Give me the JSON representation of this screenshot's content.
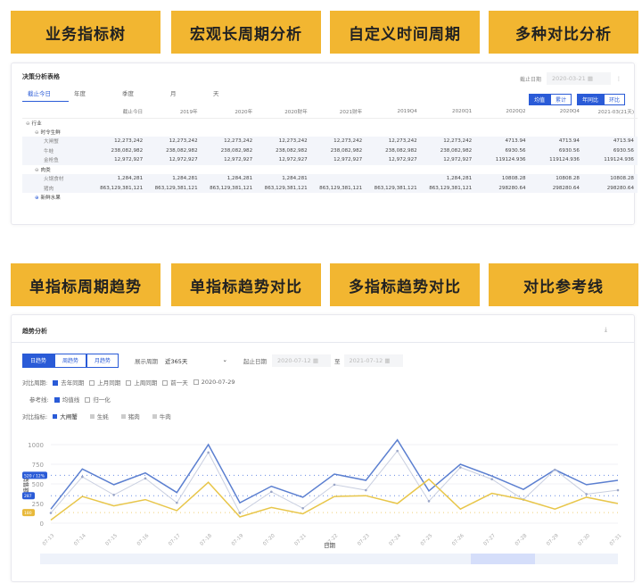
{
  "features_top": [
    "业务指标树",
    "宏观长周期分析",
    "自定义时间周期",
    "多种对比分析"
  ],
  "features_bottom": [
    "单指标周期趋势",
    "单指标趋势对比",
    "多指标趋势对比",
    "对比参考线"
  ],
  "table_panel": {
    "title": "决策分析表格",
    "tabs": [
      "截止今日",
      "年度",
      "季度",
      "月",
      "天"
    ],
    "date_label": "截止日期",
    "date_value": "2020-03-21",
    "mode_buttons": [
      "均值",
      "累计"
    ],
    "compare_buttons": [
      "年同比",
      "环比"
    ],
    "columns": [
      "截止今日",
      "2019年",
      "2020年",
      "2020财年",
      "2021财年",
      "2019Q4",
      "2020Q1",
      "2020Q2",
      "2020Q4",
      "2021-03(21天)"
    ],
    "rows": [
      {
        "label": "行业",
        "level": 0,
        "icon": "minus",
        "values": []
      },
      {
        "label": "时令生鲜",
        "level": 1,
        "icon": "minus",
        "values": []
      },
      {
        "label": "大闸蟹",
        "level": 2,
        "values": [
          "12,273,242",
          "12,273,242",
          "12,273,242",
          "12,273,242",
          "12,273,242",
          "12,273,242",
          "12,273,242",
          "4713.94",
          "4713.94",
          "4713.94"
        ]
      },
      {
        "label": "牛蛙",
        "level": 2,
        "values": [
          "238,082,982",
          "238,082,982",
          "238,082,982",
          "238,082,982",
          "238,082,982",
          "238,082,982",
          "238,082,982",
          "6930.56",
          "6930.56",
          "6930.56"
        ]
      },
      {
        "label": "金枪鱼",
        "level": 2,
        "values": [
          "12,972,927",
          "12,972,927",
          "12,972,927",
          "12,972,927",
          "12,972,927",
          "12,972,927",
          "12,972,927",
          "119124.936",
          "119124.936",
          "119124.936"
        ]
      },
      {
        "label": "肉类",
        "level": 1,
        "icon": "minus",
        "values": []
      },
      {
        "label": "火锅食材",
        "level": 2,
        "values": [
          "1,284,281",
          "1,284,281",
          "1,284,281",
          "1,284,281",
          "",
          "",
          "1,284,281",
          "10808.28",
          "10808.28",
          "10808.28"
        ]
      },
      {
        "label": "猪肉",
        "level": 2,
        "values": [
          "863,129,381,121",
          "863,129,381,121",
          "863,129,381,121",
          "863,129,381,121",
          "863,129,381,121",
          "863,129,381,121",
          "863,129,381,121",
          "298280.64",
          "298280.64",
          "298280.64"
        ]
      },
      {
        "label": "新鲜水果",
        "level": 1,
        "icon": "plus",
        "values": []
      }
    ]
  },
  "trend_panel": {
    "title": "趋势分析",
    "granularity": [
      "日趋势",
      "周趋势",
      "月趋势"
    ],
    "period_label": "展示周期",
    "period_value": "近365天",
    "range_label": "起止日期",
    "range_start": "2020-07-12",
    "range_sep": "至",
    "range_end": "2021-07-12",
    "compare_label": "对比周期:",
    "compare_options": [
      {
        "label": "去年同期",
        "checked": true
      },
      {
        "label": "上月同期",
        "checked": false
      },
      {
        "label": "上周同期",
        "checked": false
      },
      {
        "label": "前一天",
        "checked": false
      },
      {
        "label": "2020-07-29",
        "checked": false
      }
    ],
    "ref_label": "参考线:",
    "ref_options": [
      {
        "label": "均值线",
        "checked": true
      },
      {
        "label": "归一化",
        "checked": false
      }
    ],
    "metric_label": "对比指标:",
    "metrics": [
      "大闸蟹",
      "生蚝",
      "猪肉",
      "牛肉"
    ]
  },
  "chart_data": {
    "type": "line",
    "xlabel": "日期",
    "ylabel": "销售额",
    "ylim": [
      0,
      1000
    ],
    "yticks": [
      "0",
      "250",
      "500",
      "750",
      "1000"
    ],
    "categories": [
      "07-13",
      "07-14",
      "07-15",
      "07-16",
      "07-17",
      "07-18",
      "07-19",
      "07-20",
      "07-21",
      "07-22",
      "07-23",
      "07-24",
      "07-25",
      "07-26",
      "07-27",
      "07-28",
      "07-29",
      "07-30",
      "07-31"
    ],
    "series": [
      {
        "name": "大闸蟹",
        "color": "#5b7fd0",
        "values": [
          180,
          690,
          490,
          640,
          390,
          1000,
          260,
          470,
          330,
          625,
          545,
          1060,
          410,
          750,
          600,
          430,
          680,
          490,
          545
        ]
      },
      {
        "name": "去年同期",
        "color": "#c9cfe0",
        "values": [
          130,
          590,
          360,
          570,
          260,
          900,
          130,
          400,
          190,
          490,
          420,
          920,
          280,
          710,
          560,
          300,
          680,
          370,
          420
        ]
      },
      {
        "name": "猪肉",
        "color": "#e8c64a",
        "values": [
          40,
          340,
          220,
          300,
          160,
          520,
          80,
          200,
          120,
          340,
          350,
          250,
          560,
          180,
          380,
          300,
          180,
          330,
          250
        ]
      }
    ],
    "reference_lines": [
      {
        "label": "520 / 12%",
        "value": 610,
        "color": "#2a5bd7"
      },
      {
        "label": "287",
        "value": 350,
        "color": "#2a5bd7"
      },
      {
        "label": "180",
        "value": 135,
        "color": "#e8b93a"
      }
    ]
  }
}
